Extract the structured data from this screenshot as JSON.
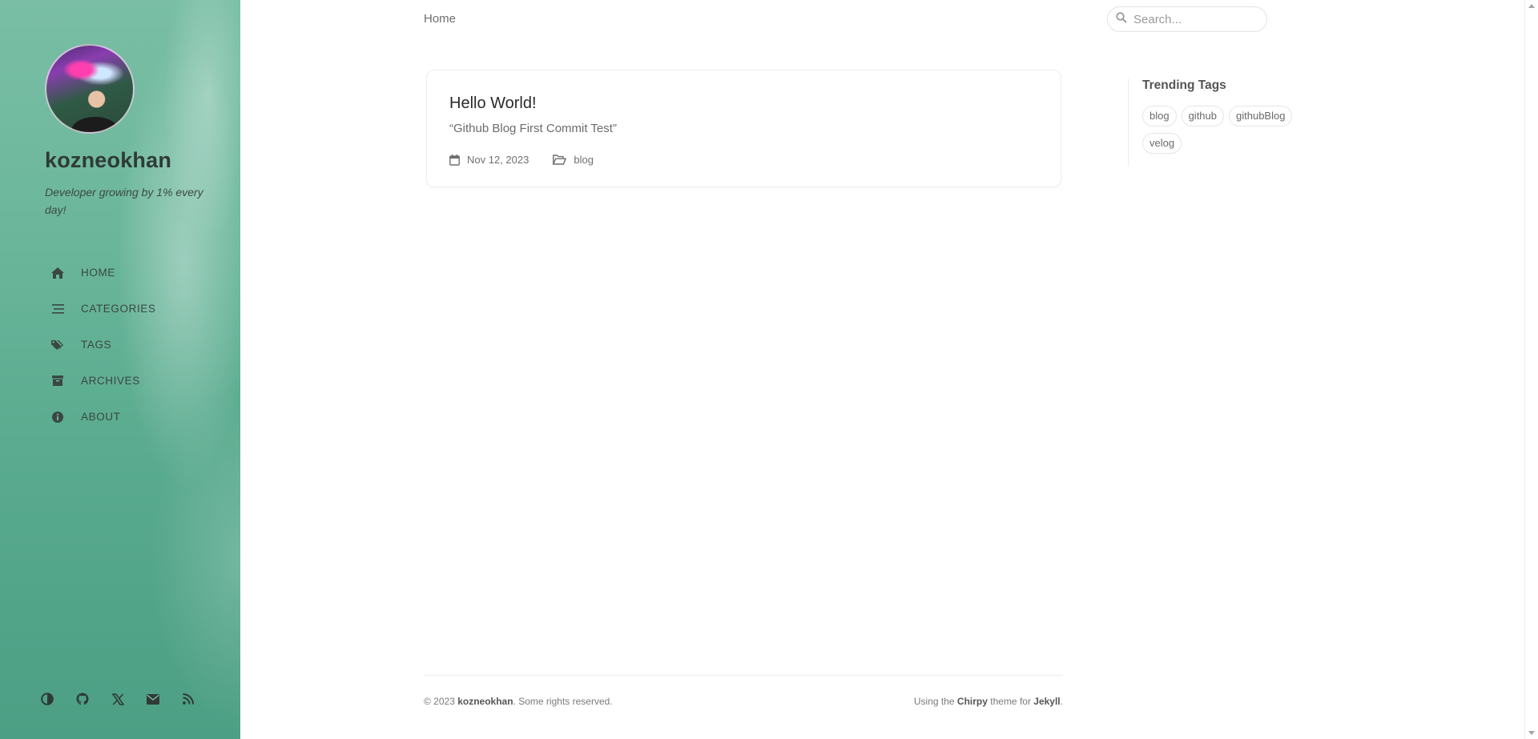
{
  "sidebar": {
    "title": "kozneokhan",
    "subtitle": "Developer growing by 1% every day!",
    "nav": [
      {
        "label": "HOME",
        "icon": "home-icon"
      },
      {
        "label": "CATEGORIES",
        "icon": "stream-icon"
      },
      {
        "label": "TAGS",
        "icon": "tags-icon"
      },
      {
        "label": "ARCHIVES",
        "icon": "archive-icon"
      },
      {
        "label": "ABOUT",
        "icon": "info-icon"
      }
    ],
    "bottom_icons": [
      "theme-toggle-icon",
      "github-icon",
      "x-twitter-icon",
      "email-icon",
      "rss-icon"
    ]
  },
  "topbar": {
    "breadcrumb": "Home",
    "search_placeholder": "Search..."
  },
  "post": {
    "title": "Hello World!",
    "excerpt": "“Github Blog First Commit Test”",
    "date": "Nov 12, 2023",
    "category": "blog"
  },
  "trending": {
    "heading": "Trending Tags",
    "tags": [
      "blog",
      "github",
      "githubBlog",
      "velog"
    ]
  },
  "footer": {
    "copyright_prefix": "© 2023 ",
    "owner": "kozneokhan",
    "copyright_suffix": ". Some rights reserved.",
    "using_prefix": "Using the ",
    "theme": "Chirpy",
    "theme_mid": " theme for ",
    "engine": "Jekyll",
    "suffix": "."
  },
  "colors": {
    "sidebar_accent": "#5aab8f",
    "text_primary": "#2a2a2a"
  }
}
